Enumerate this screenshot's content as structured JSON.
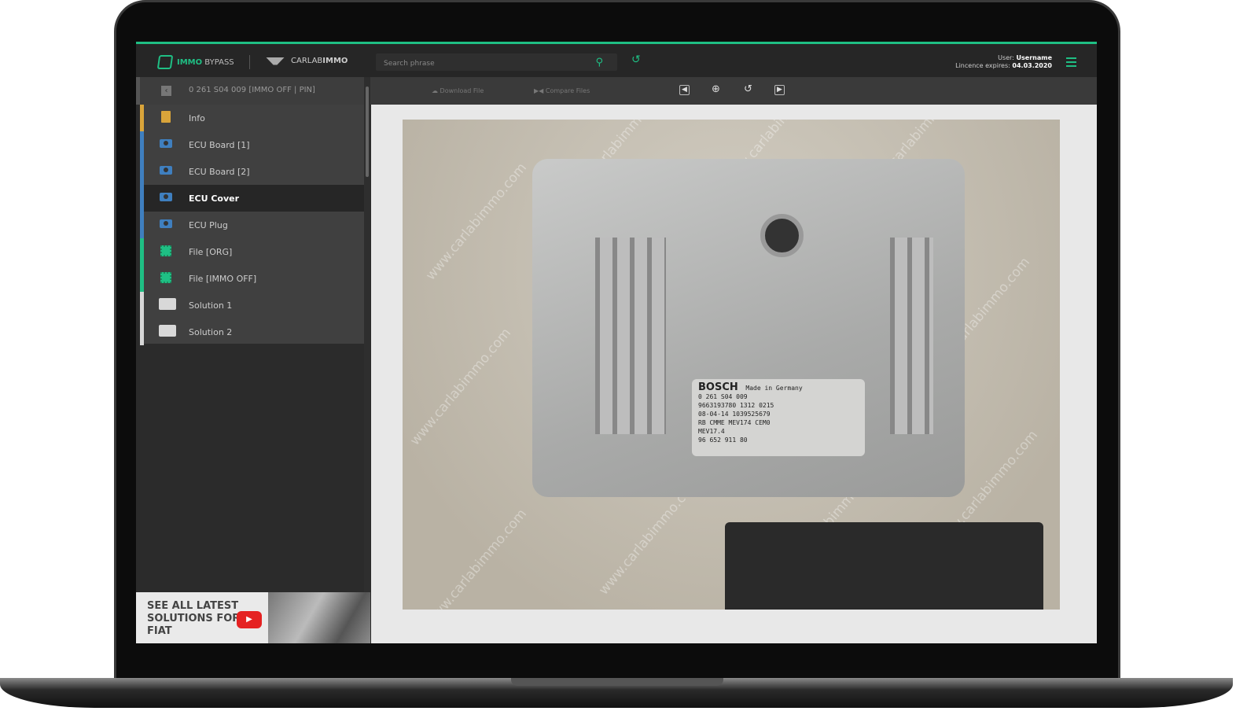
{
  "header": {
    "brand_strong": "IMMO",
    "brand_rest": " BYPASS",
    "partner_regular": "CARLAB",
    "partner_strong": "IMMO",
    "search_placeholder": "Search phrase",
    "user_label": "User: ",
    "user_name": "Username",
    "licence_label": "Lincence expires: ",
    "licence_date": "04.03.2020"
  },
  "breadcrumb": "0 261 S04 009 [IMMO OFF | PIN]",
  "toolbar": {
    "download": "Download File",
    "compare": "Compare Files"
  },
  "sidebar": {
    "items": [
      {
        "label": "Info",
        "icon": "document-icon",
        "color": "#d9a43a"
      },
      {
        "label": "ECU Board [1]",
        "icon": "camera-icon",
        "color": "#3f7fbf"
      },
      {
        "label": "ECU Board [2]",
        "icon": "camera-icon",
        "color": "#3f7fbf"
      },
      {
        "label": "ECU Cover",
        "icon": "camera-icon",
        "color": "#3f7fbf",
        "active": true
      },
      {
        "label": "ECU Plug",
        "icon": "camera-icon",
        "color": "#3f7fbf"
      },
      {
        "label": "File [ORG]",
        "icon": "chip-icon",
        "color": "#1fbf84"
      },
      {
        "label": "File [IMMO OFF]",
        "icon": "chip-icon",
        "color": "#1fbf84"
      },
      {
        "label": "Solution 1",
        "icon": "folder-icon",
        "color": "#d8d8d8"
      },
      {
        "label": "Solution 2",
        "icon": "folder-icon",
        "color": "#d8d8d8"
      }
    ]
  },
  "promo": {
    "text": "SEE ALL LATEST SOLUTIONS FOR FIAT"
  },
  "photo": {
    "watermark": "www.carlabimmo.com",
    "label": {
      "brand": "BOSCH",
      "part": "0 261 S04 009",
      "made": "Made in Germany",
      "line1": "9663193780 1312 0215",
      "line2": "08-04-14 1039525679",
      "line3": "RB CMME MEV174 CEM0",
      "line4": "MEV17.4",
      "line5": "96 652 911 80"
    }
  },
  "colors": {
    "accent": "#1fbf84"
  }
}
